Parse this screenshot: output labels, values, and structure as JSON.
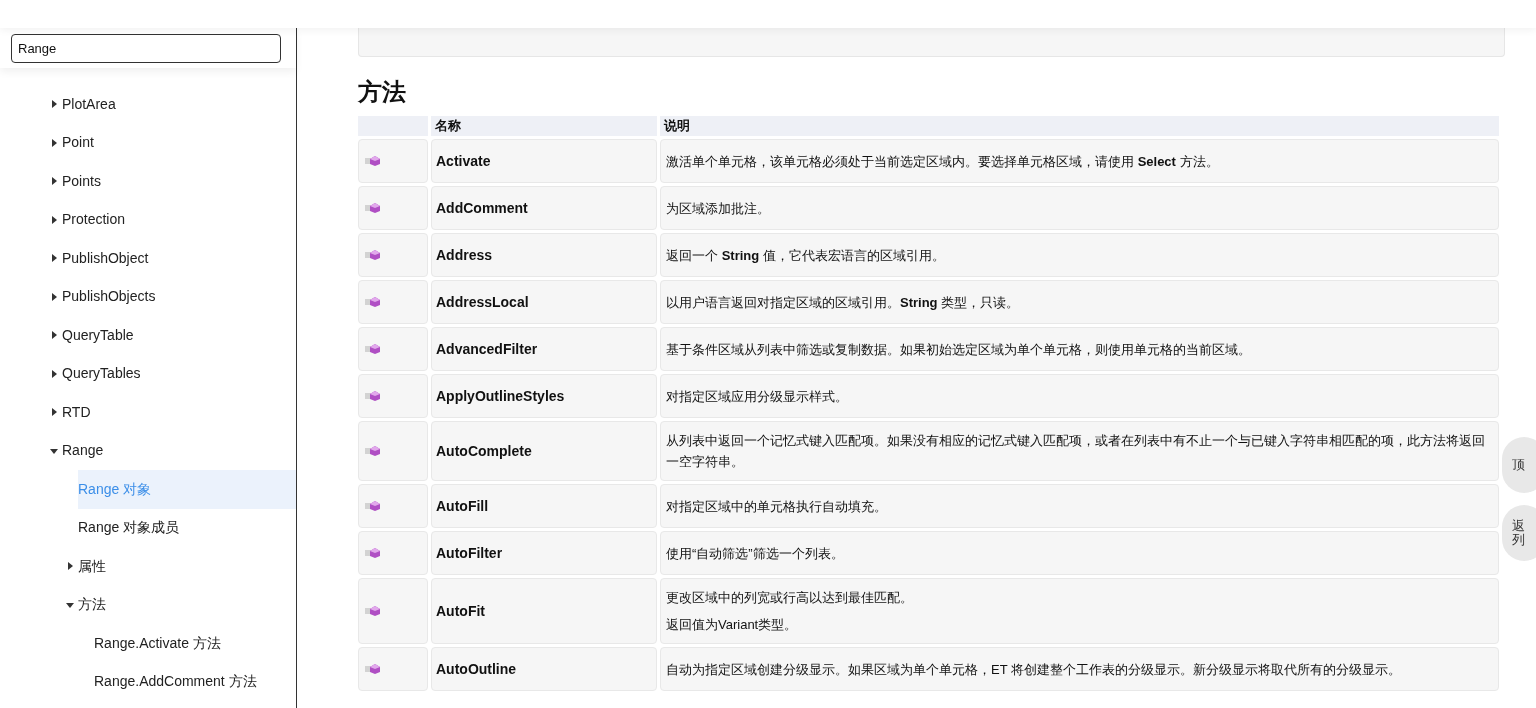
{
  "search": {
    "value": "Range"
  },
  "sidebar": {
    "items": [
      {
        "label": "PlotArea",
        "expanded": false
      },
      {
        "label": "Point",
        "expanded": false
      },
      {
        "label": "Points",
        "expanded": false
      },
      {
        "label": "Protection",
        "expanded": false
      },
      {
        "label": "PublishObject",
        "expanded": false
      },
      {
        "label": "PublishObjects",
        "expanded": false
      },
      {
        "label": "QueryTable",
        "expanded": false
      },
      {
        "label": "QueryTables",
        "expanded": false
      },
      {
        "label": "RTD",
        "expanded": false
      },
      {
        "label": "Range",
        "expanded": true,
        "children": [
          {
            "label": "Range 对象",
            "selected": true
          },
          {
            "label": "Range 对象成员",
            "selected": false
          },
          {
            "label": "属性",
            "expanded": false,
            "selected": false
          },
          {
            "label": "方法",
            "expanded": true,
            "selected": false,
            "children": [
              {
                "label": "Range.Activate 方法",
                "selected": false
              },
              {
                "label": "Range.AddComment 方法",
                "selected": false
              }
            ]
          }
        ]
      }
    ]
  },
  "content": {
    "heading": "方法",
    "table": {
      "columns": [
        "名称",
        "说明"
      ],
      "rows": [
        {
          "name": "Activate",
          "description": [
            "激活单个单元格，该单元格必须处于当前选定区域内。要选择单元格区域，请使用 **Select** 方法。"
          ]
        },
        {
          "name": "AddComment",
          "description": [
            "为区域添加批注。"
          ]
        },
        {
          "name": "Address",
          "description": [
            "返回一个 **String** 值，它代表宏语言的区域引用。"
          ]
        },
        {
          "name": "AddressLocal",
          "description": [
            "以用户语言返回对指定区域的区域引用。**String** 类型，只读。"
          ]
        },
        {
          "name": "AdvancedFilter",
          "description": [
            "基于条件区域从列表中筛选或复制数据。如果初始选定区域为单个单元格，则使用单元格的当前区域。"
          ]
        },
        {
          "name": "ApplyOutlineStyles",
          "description": [
            "对指定区域应用分级显示样式。"
          ]
        },
        {
          "name": "AutoComplete",
          "description": [
            "从列表中返回一个记忆式键入匹配项。如果没有相应的记忆式键入匹配项，或者在列表中有不止一个与已键入字符串相匹配的项，此方法将返回一空字符串。"
          ]
        },
        {
          "name": "AutoFill",
          "description": [
            "对指定区域中的单元格执行自动填充。"
          ]
        },
        {
          "name": "AutoFilter",
          "description": [
            "使用“自动筛选”筛选一个列表。"
          ]
        },
        {
          "name": "AutoFit",
          "description": [
            "更改区域中的列宽或行高以达到最佳匹配。",
            "返回值为Variant类型。"
          ]
        },
        {
          "name": "AutoOutline",
          "description": [
            "自动为指定区域创建分级显示。如果区域为单个单元格，ET 将创建整个工作表的分级显示。新分级显示将取代所有的分级显示。"
          ]
        }
      ]
    }
  },
  "float_buttons": [
    "顶",
    "返列"
  ]
}
